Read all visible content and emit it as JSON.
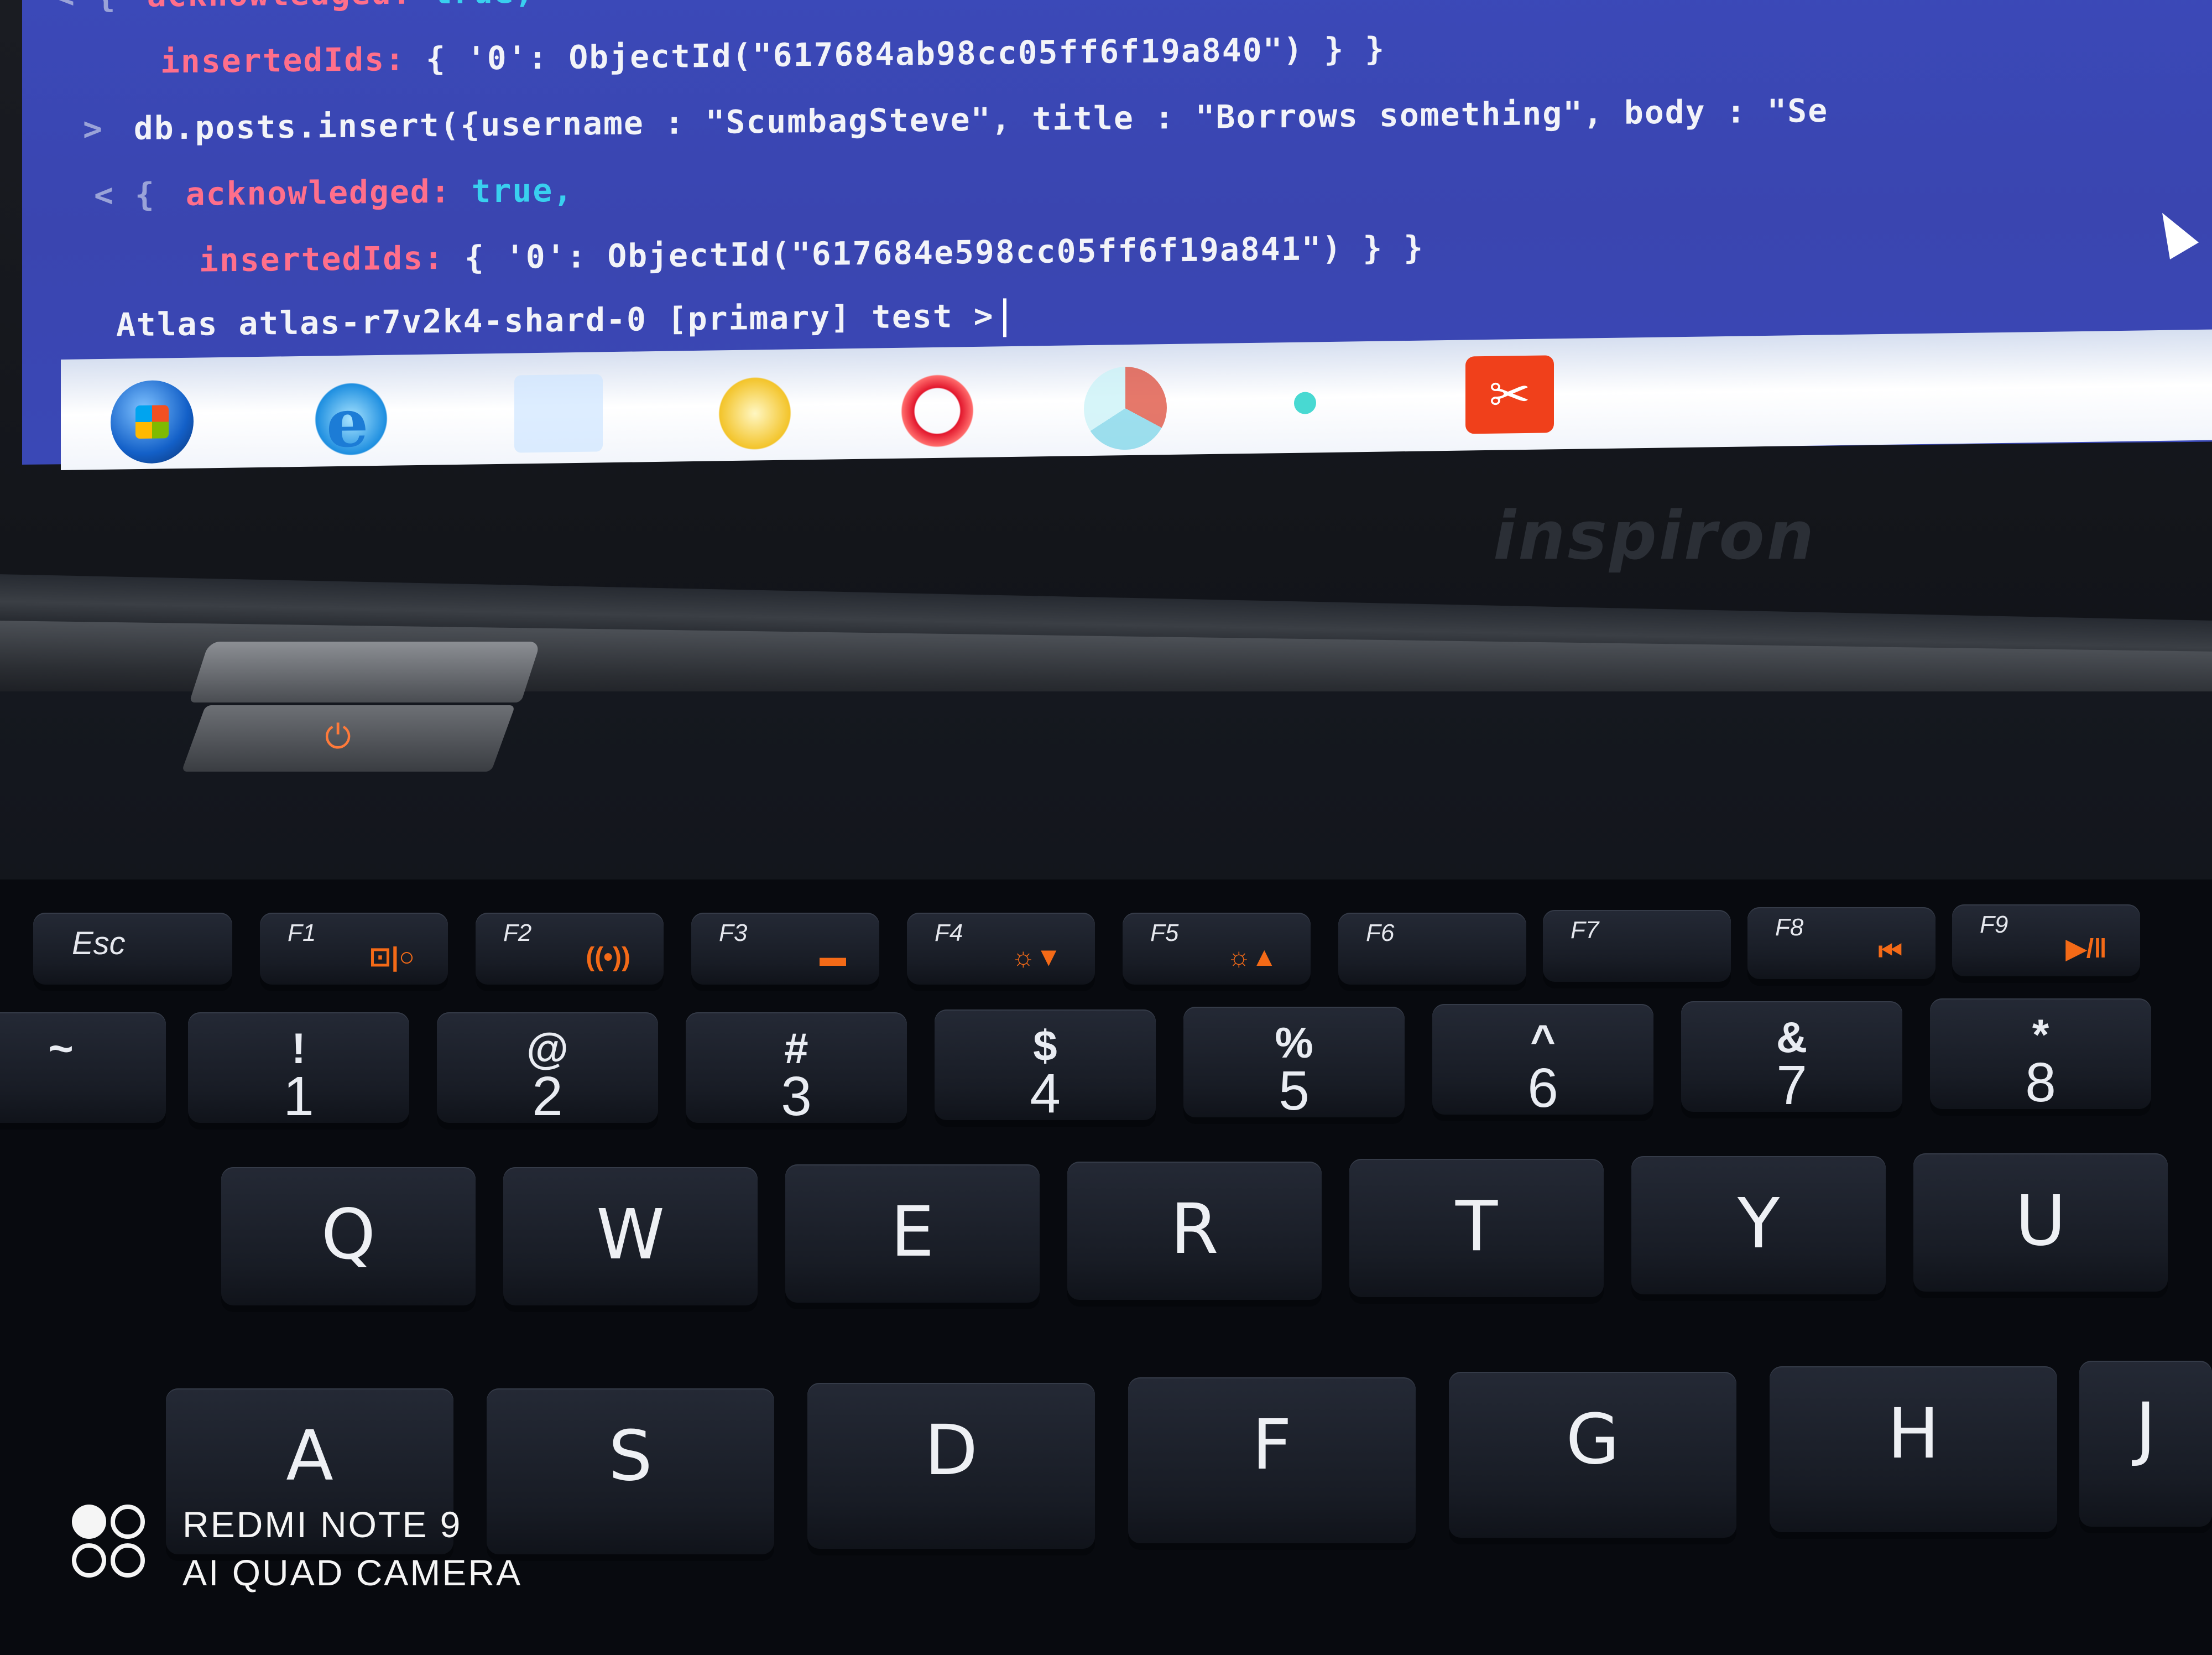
{
  "terminal": {
    "lines": [
      {
        "prefix": "< {",
        "key": "acknowledged:",
        "value": "true,"
      },
      {
        "key": "insertedIds:",
        "text": "{ '0': ObjectId(\"617684ab98cc05ff6f19a840\") } }"
      },
      {
        "prefix": ">",
        "text": "db.posts.insert({username : \"ScumbagSteve\", title : \"Borrows something\", body : \"Se"
      },
      {
        "prefix": "< {",
        "key": "acknowledged:",
        "value": "true,"
      },
      {
        "key": "insertedIds:",
        "text": "{ '0': ObjectId(\"617684e598cc05ff6f19a841\") } }"
      },
      {
        "text": "Atlas atlas-r7v2k4-shard-0 [primary] test >"
      }
    ]
  },
  "taskbar": {
    "icons": [
      "start-orb-icon",
      "internet-explorer-icon",
      "folder-icon",
      "media-player-icon",
      "opera-icon",
      "chrome-icon",
      "app-dot-icon",
      "acrobat-icon"
    ],
    "ie_glyph": "e",
    "acrobat_glyph": "✂"
  },
  "laptop": {
    "brand": "inspiron",
    "power_glyph": "⏻"
  },
  "keyboard": {
    "esc": "Esc",
    "fkeys": [
      {
        "label": "F1",
        "sym": "⊡|○"
      },
      {
        "label": "F2",
        "sym": "((•))"
      },
      {
        "label": "F3",
        "sym": "▬"
      },
      {
        "label": "F4",
        "sym": "☼▼"
      },
      {
        "label": "F5",
        "sym": "☼▲"
      },
      {
        "label": "F6",
        "sym": ""
      },
      {
        "label": "F7",
        "sym": ""
      },
      {
        "label": "F8",
        "sym": "⏮"
      },
      {
        "label": "F9",
        "sym": "▶/‖"
      }
    ],
    "numbers": [
      {
        "sym": "~",
        "num": ""
      },
      {
        "sym": "!",
        "num": "1"
      },
      {
        "sym": "@",
        "num": "2"
      },
      {
        "sym": "#",
        "num": "3"
      },
      {
        "sym": "$",
        "num": "4"
      },
      {
        "sym": "%",
        "num": "5"
      },
      {
        "sym": "^",
        "num": "6"
      },
      {
        "sym": "&",
        "num": "7"
      },
      {
        "sym": "*",
        "num": "8"
      }
    ],
    "row_q": [
      "Q",
      "W",
      "E",
      "R",
      "T",
      "Y",
      "U"
    ],
    "row_a": [
      "A",
      "S",
      "D",
      "F",
      "G",
      "H",
      "J"
    ]
  },
  "watermark": {
    "line1": "REDMI NOTE 9",
    "line2": "AI QUAD CAMERA"
  },
  "colors": {
    "screen_bg": "#3a45b0",
    "key_text": "#ff6f8b",
    "value_text": "#39d0ef",
    "fn_accent": "#f46a17"
  }
}
